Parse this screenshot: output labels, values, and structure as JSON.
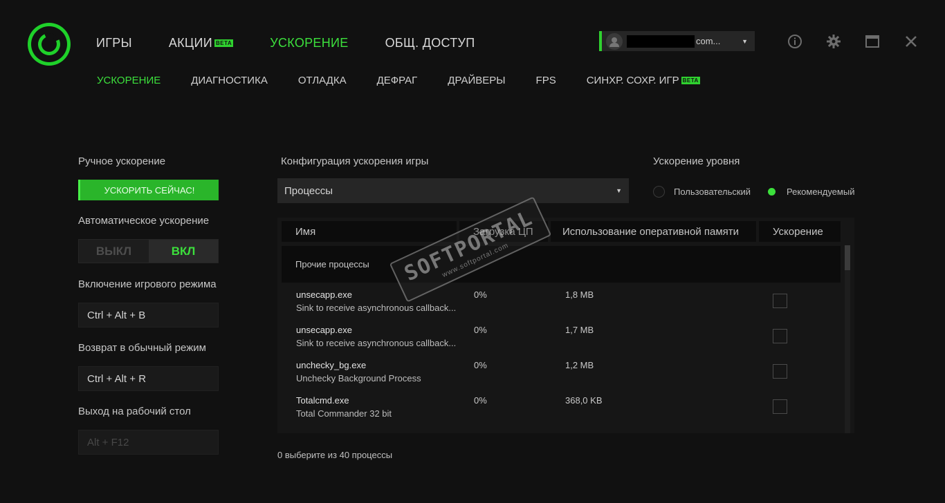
{
  "main_nav": [
    {
      "label": "ИГРЫ",
      "beta": false,
      "active": false
    },
    {
      "label": "АКЦИИ",
      "beta": true,
      "active": false
    },
    {
      "label": "УСКОРЕНИЕ",
      "beta": false,
      "active": true
    },
    {
      "label": "ОБЩ. ДОСТУП",
      "beta": false,
      "active": false
    }
  ],
  "beta_label": "BETA",
  "sub_nav": [
    {
      "label": "УСКОРЕНИЕ",
      "beta": false,
      "active": true
    },
    {
      "label": "ДИАГНОСТИКА",
      "beta": false,
      "active": false
    },
    {
      "label": "ОТЛАДКА",
      "beta": false,
      "active": false
    },
    {
      "label": "ДЕФРАГ",
      "beta": false,
      "active": false
    },
    {
      "label": "ДРАЙВЕРЫ",
      "beta": false,
      "active": false
    },
    {
      "label": "FPS",
      "beta": false,
      "active": false
    },
    {
      "label": "СИНХР. СОХР. ИГР",
      "beta": true,
      "active": false
    }
  ],
  "user": {
    "email_suffix": "com..."
  },
  "left": {
    "manual_label": "Ручное ускорение",
    "boost_button": "УСКОРИТЬ СЕЙЧАС!",
    "auto_label": "Автоматическое ускорение",
    "toggle_off": "ВЫКЛ",
    "toggle_on": "ВКЛ",
    "game_mode_label": "Включение игрового режима",
    "game_mode_hotkey": "Ctrl + Alt + B",
    "normal_mode_label": "Возврат в обычный режим",
    "normal_mode_hotkey": "Ctrl + Alt + R",
    "desktop_label": "Выход на рабочий стол",
    "desktop_hotkey": "Alt + F12"
  },
  "config": {
    "label": "Конфигурация ускорения игры",
    "selected": "Процессы"
  },
  "level": {
    "label": "Ускорение уровня",
    "custom": "Пользовательский",
    "recommended": "Рекомендуемый"
  },
  "table": {
    "headers": [
      "Имя",
      "Загрузка ЦП",
      "Использование оперативной памяти",
      "Ускорение"
    ],
    "group": "Прочие процессы",
    "rows": [
      {
        "name": "unsecapp.exe",
        "desc": "Sink to receive asynchronous callback...",
        "cpu": "0%",
        "mem": "1,8 MB"
      },
      {
        "name": "unsecapp.exe",
        "desc": "Sink to receive asynchronous callback...",
        "cpu": "0%",
        "mem": "1,7 MB"
      },
      {
        "name": "unchecky_bg.exe",
        "desc": "Unchecky Background Process",
        "cpu": "0%",
        "mem": "1,2 MB"
      },
      {
        "name": "Totalcmd.exe",
        "desc": "Total Commander 32 bit",
        "cpu": "0%",
        "mem": "368,0 KB"
      }
    ]
  },
  "footer": "0 выберите из 40 процессы",
  "watermark": {
    "big": "SOFTPORTAL",
    "small": "www.softportal.com"
  },
  "colors": {
    "accent": "#3ce03c",
    "button": "#2ab52a",
    "background": "#111111"
  }
}
